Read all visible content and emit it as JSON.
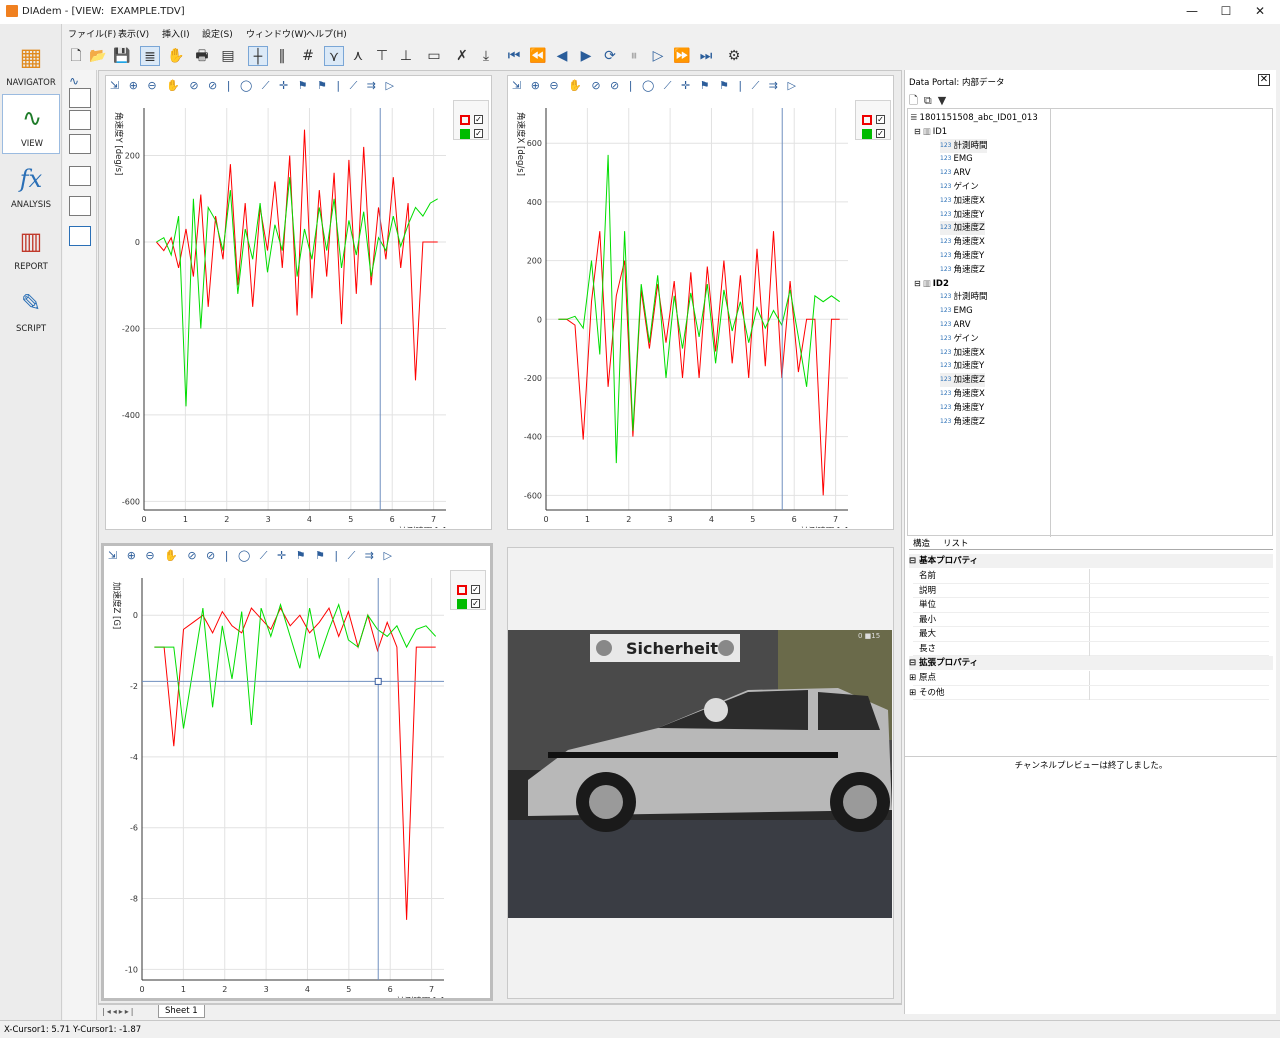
{
  "window": {
    "title": "DIAdem - [VIEW:  EXAMPLE.TDV]",
    "minimize": "—",
    "maximize": "☐",
    "close": "✕"
  },
  "menu": [
    "ファイル(F)",
    "表示(V)",
    "挿入(I)",
    "設定(S)",
    "ウィンドウ(W)",
    "ヘルプ(H)"
  ],
  "nav": [
    {
      "label": "NAVIGATOR",
      "icon": "navigator-icon",
      "selected": false
    },
    {
      "label": "VIEW",
      "icon": "view-icon",
      "selected": true
    },
    {
      "label": "ANALYSIS",
      "icon": "analysis-icon",
      "selected": false
    },
    {
      "label": "REPORT",
      "icon": "report-icon",
      "selected": false
    },
    {
      "label": "SCRIPT",
      "icon": "script-icon",
      "selected": false
    }
  ],
  "chart_data": [
    {
      "type": "line",
      "panel": "top-left",
      "ylabel": "角速度Y [deg/s]",
      "xlabel": "計測時間 [s]",
      "xlim": [
        0,
        7.3
      ],
      "ylim": [
        -620,
        310
      ],
      "xticks": [
        "0",
        "1",
        "2",
        "3",
        "4",
        "5",
        "6",
        "7"
      ],
      "yticks": [
        "200",
        "0",
        "-200",
        "-400",
        "-600"
      ],
      "cursor_x": 5.71,
      "series": [
        {
          "color": "#ff0000",
          "values": [
            0,
            -20,
            10,
            -60,
            30,
            -80,
            110,
            -150,
            60,
            -40,
            180,
            -100,
            90,
            -150,
            80,
            -20,
            140,
            -60,
            200,
            -170,
            260,
            -130,
            120,
            -80,
            160,
            -190,
            190,
            -120,
            220,
            -100,
            80,
            -40,
            150,
            -60,
            90,
            -320,
            0,
            0,
            0
          ]
        },
        {
          "color": "#00dd00",
          "values": [
            0,
            10,
            -30,
            60,
            -380,
            100,
            -200,
            80,
            50,
            -20,
            120,
            -120,
            30,
            -40,
            90,
            -70,
            40,
            -20,
            150,
            -80,
            30,
            -40,
            80,
            -20,
            100,
            -60,
            50,
            -30,
            70,
            -80,
            10,
            -20,
            60,
            -10,
            40,
            80,
            60,
            90,
            100
          ]
        }
      ]
    },
    {
      "type": "line",
      "panel": "top-right",
      "ylabel": "角速度X [deg/s]",
      "xlabel": "計測時間 [s]",
      "xlim": [
        0,
        7.3
      ],
      "ylim": [
        -650,
        720
      ],
      "xticks": [
        "0",
        "1",
        "2",
        "3",
        "4",
        "5",
        "6",
        "7"
      ],
      "yticks": [
        "600",
        "400",
        "200",
        "0",
        "-200",
        "-400",
        "-600"
      ],
      "cursor_x": 5.71,
      "series": [
        {
          "color": "#ff0000",
          "values": [
            0,
            0,
            -20,
            -410,
            60,
            300,
            -230,
            80,
            200,
            -400,
            100,
            -100,
            120,
            -80,
            130,
            -200,
            160,
            -200,
            180,
            -110,
            200,
            -150,
            150,
            -200,
            240,
            -160,
            300,
            -200,
            130,
            -180,
            0,
            0,
            -600,
            0,
            0
          ]
        },
        {
          "color": "#00dd00",
          "values": [
            0,
            0,
            10,
            -30,
            200,
            -120,
            560,
            -490,
            300,
            -380,
            120,
            -80,
            150,
            -200,
            80,
            -100,
            90,
            -60,
            120,
            -150,
            100,
            -40,
            60,
            -80,
            40,
            -30,
            30,
            -20,
            100,
            -60,
            -230,
            80,
            60,
            80,
            60
          ]
        }
      ]
    },
    {
      "type": "line",
      "panel": "bottom-left",
      "ylabel": "加速度Z [G]",
      "xlabel": "計測時間 [s]",
      "xlim": [
        0,
        7.3
      ],
      "ylim": [
        -10.3,
        1.05
      ],
      "xticks": [
        "0",
        "1",
        "2",
        "3",
        "4",
        "5",
        "6",
        "7"
      ],
      "yticks": [
        "0",
        "-2",
        "-4",
        "-6",
        "-8",
        "-10"
      ],
      "cursor_x": 5.71,
      "cursor_y": -1.87,
      "series": [
        {
          "color": "#ff0000",
          "values": [
            -0.9,
            -0.9,
            -3.7,
            -0.4,
            -0.2,
            0.0,
            -0.5,
            0.1,
            -0.3,
            -0.5,
            0.2,
            -0.1,
            -0.4,
            0.2,
            -0.3,
            0.0,
            -0.5,
            -0.2,
            0.2,
            -0.6,
            0.1,
            -0.9,
            0.0,
            -1.0,
            -0.2,
            -0.9,
            -8.6,
            -0.9,
            -0.9,
            -0.9
          ]
        },
        {
          "color": "#00dd00",
          "values": [
            -0.9,
            -0.9,
            -0.9,
            -3.2,
            -1.5,
            0.2,
            -2.6,
            -0.3,
            -1.8,
            0.1,
            -3.1,
            0.2,
            -0.6,
            0.3,
            -0.6,
            -1.5,
            0.2,
            -1.2,
            -0.4,
            0.3,
            -0.7,
            -0.9,
            0.0,
            -0.4,
            -0.6,
            -0.3,
            -0.9,
            -0.4,
            -0.3,
            -0.6
          ]
        }
      ]
    }
  ],
  "video": {
    "banner": "Sicherheit",
    "overlay": "0  ■15"
  },
  "sheet_tab": "Sheet 1",
  "status": "X-Cursor1: 5.71  Y-Cursor1: -1.87",
  "portal": {
    "title": "Data Portal: 内部データ",
    "root": "1801151508_abc_ID01_013",
    "groups": [
      {
        "name": "ID1",
        "channels": [
          "計測時間",
          "EMG",
          "ARV",
          "ゲイン",
          "加速度X",
          "加速度Y",
          "加速度Z",
          "角速度X",
          "角速度Y",
          "角速度Z"
        ]
      },
      {
        "name": "ID2",
        "channels": [
          "計測時間",
          "EMG",
          "ARV",
          "ゲイン",
          "加速度X",
          "加速度Y",
          "加速度Z",
          "角速度X",
          "角速度Y",
          "角速度Z"
        ]
      }
    ],
    "tabs": [
      "構造",
      "リスト"
    ],
    "basic_props_header": "基本プロパティ",
    "basic_props": [
      "名前",
      "説明",
      "単位",
      "最小",
      "最大",
      "長さ"
    ],
    "ext_props_header": "拡張プロパティ",
    "ext_props": [
      "原点",
      "その他"
    ],
    "preview_msg": "チャンネルプレビューは終了しました。"
  }
}
